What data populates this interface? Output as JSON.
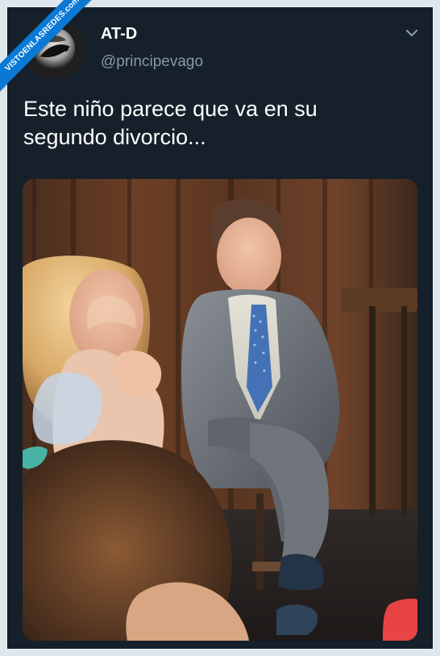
{
  "tweet": {
    "display_name": "AT-D",
    "handle": "@principevago",
    "text": "Este niño parece que va en su segundo divorcio..."
  },
  "watermark": {
    "label": "VISTOENLASREDES.com"
  },
  "media": {
    "description_icon": "photo-image",
    "colors": {
      "panel": "#6b3e23",
      "accent": "#0a79d6"
    }
  },
  "icons": {
    "menu": "chevron-down-icon",
    "avatar": "avatar-image"
  },
  "colors": {
    "background": "#15202b",
    "text": "#ffffff",
    "muted": "#8899a6",
    "badge": "#0a79d6"
  }
}
